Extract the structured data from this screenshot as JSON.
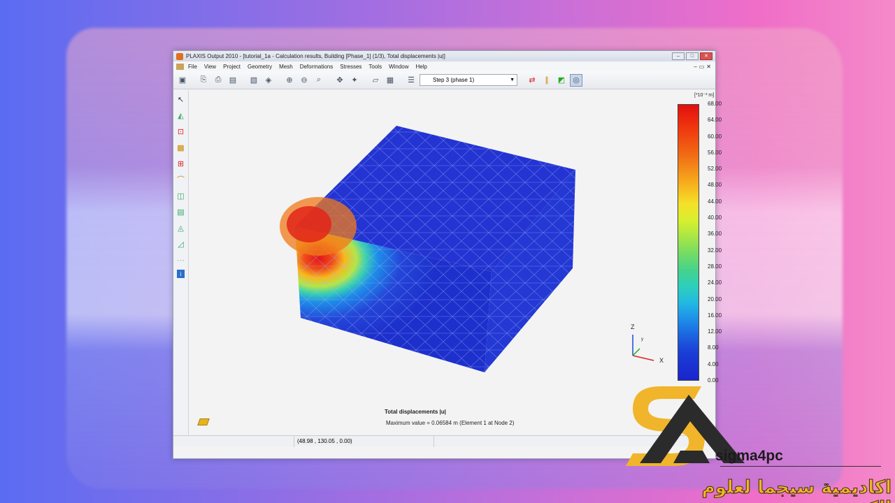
{
  "window": {
    "title": "PLAXIS Output 2010 - [tutorial_1a - Calculation results, Building [Phase_1] (1/3), Total displacements |u|]"
  },
  "menu": [
    "File",
    "View",
    "Project",
    "Geometry",
    "Mesh",
    "Deformations",
    "Stresses",
    "Tools",
    "Window",
    "Help"
  ],
  "toolbar": {
    "step_select": "Step 3 (phase 1)"
  },
  "legend": {
    "unit": "[*10⁻³ m]",
    "labels": [
      "68.00",
      "64.00",
      "60.00",
      "56.00",
      "52.00",
      "48.00",
      "44.00",
      "40.00",
      "36.00",
      "32.00",
      "28.00",
      "24.00",
      "20.00",
      "16.00",
      "12.00",
      "8.00",
      "4.00",
      "0.00"
    ]
  },
  "axes": {
    "z": "Z",
    "x": "X",
    "y": "y"
  },
  "info": {
    "title": "Total displacements |u|",
    "max_value": "Maximum value = 0.06584 m (Element 1 at Node 2)"
  },
  "status": {
    "coords": "(48.98 , 130.05 , 0.00)"
  },
  "logo": {
    "brand": "sigma4pc",
    "arabic": "اكاديمية سيجما لعلوم الكمبيوتر",
    "colors": {
      "gold": "#f0b52a",
      "dark": "#2b2b2b"
    }
  },
  "colors": {
    "max": "#e01010",
    "min": "#1a24cc"
  }
}
